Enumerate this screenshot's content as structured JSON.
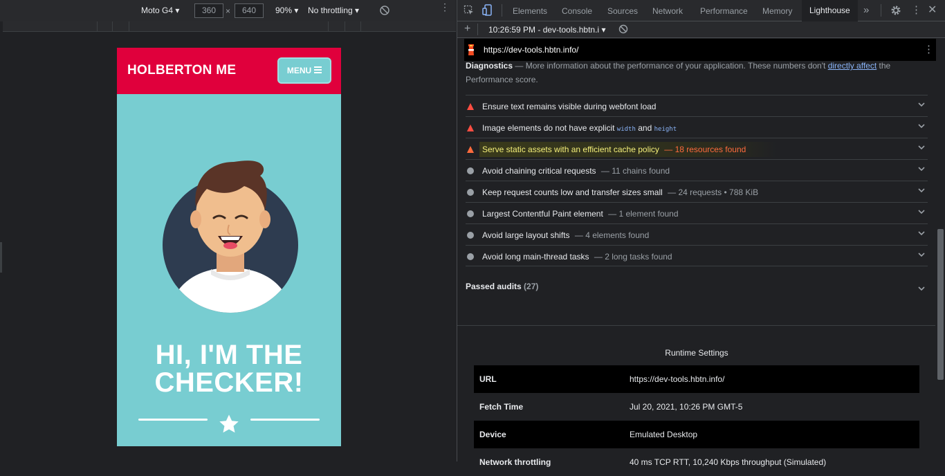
{
  "device_toolbar": {
    "device": "Moto G4",
    "width": "360",
    "times": "×",
    "height": "640",
    "zoom": "90%",
    "throttling": "No throttling"
  },
  "site": {
    "brand": "HOLBERTON ME",
    "menu_label": "MENU",
    "hero_line1": "HI, I'M THE",
    "hero_line2": "CHECKER!"
  },
  "devtools": {
    "tabs": [
      "Elements",
      "Console",
      "Sources",
      "Network",
      "Performance",
      "Memory",
      "Lighthouse"
    ],
    "more_tabs": "»",
    "report_selector": "10:26:59 PM - dev-tools.hbtn.i",
    "report_url": "https://dev-tools.hbtn.info/"
  },
  "diagnostics": {
    "heading": "Diagnostics",
    "dash": "—",
    "text_before": "More information about the performance of your application. These numbers don't",
    "link": "directly affect",
    "text_after": "the Performance score."
  },
  "audits": [
    {
      "title": "Ensure text remains visible during webfont load",
      "detail": "",
      "status": "fail"
    },
    {
      "title_a": "Image elements do not have explicit",
      "code1": "width",
      "and": "and",
      "code2": "height",
      "status": "fail"
    },
    {
      "title": "Serve static assets with an efficient cache policy",
      "detail": "— 18 resources found",
      "status": "fail"
    },
    {
      "title": "Avoid chaining critical requests",
      "detail": "— 11 chains found",
      "status": "info"
    },
    {
      "title": "Keep request counts low and transfer sizes small",
      "detail": "— 24 requests • 788 KiB",
      "status": "info"
    },
    {
      "title": "Largest Contentful Paint element",
      "detail": "— 1 element found",
      "status": "info"
    },
    {
      "title": "Avoid large layout shifts",
      "detail": "— 4 elements found",
      "status": "info"
    },
    {
      "title": "Avoid long main-thread tasks",
      "detail": "— 2 long tasks found",
      "status": "info"
    }
  ],
  "passed": {
    "label": "Passed audits",
    "count": "(27)"
  },
  "runtime": {
    "title": "Runtime Settings",
    "rows": [
      {
        "key": "URL",
        "value": "https://dev-tools.hbtn.info/"
      },
      {
        "key": "Fetch Time",
        "value": "Jul 20, 2021, 10:26 PM GMT-5"
      },
      {
        "key": "Device",
        "value": "Emulated Desktop"
      },
      {
        "key": "Network throttling",
        "value": "40 ms TCP RTT, 10,240 Kbps throughput (Simulated)"
      }
    ]
  },
  "colors": {
    "brand_red": "#e0003c",
    "teal": "#78cdd1",
    "fail_red": "#ff4e42",
    "warn_orange": "#ff6b3d",
    "link_blue": "#8ab4f8"
  }
}
